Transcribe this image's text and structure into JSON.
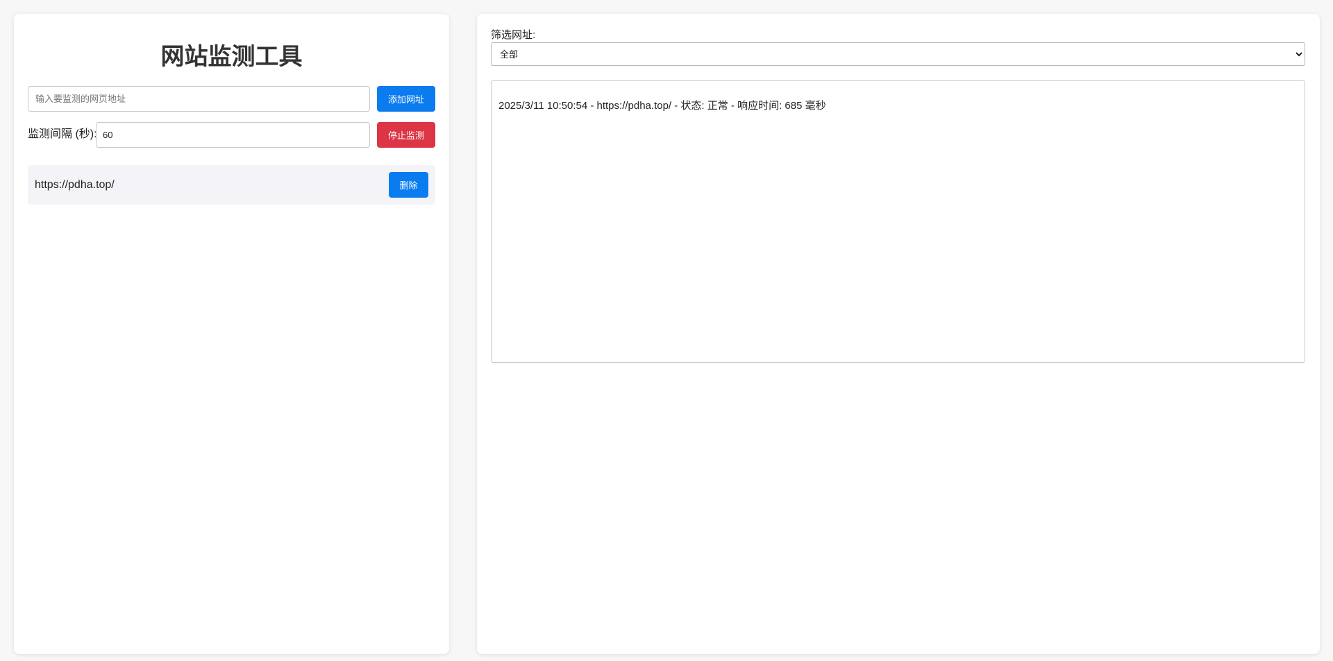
{
  "left_panel": {
    "title": "网站监测工具",
    "url_input": {
      "placeholder": "输入要监测的网页地址",
      "value": ""
    },
    "add_button_label": "添加网址",
    "interval_label": "监测间隔 (秒):",
    "interval_value": "60",
    "stop_button_label": "停止监测",
    "url_list": [
      {
        "url": "https://pdha.top/",
        "delete_label": "删除"
      }
    ]
  },
  "right_panel": {
    "filter_label": "筛选网址:",
    "filter_selected": "全部",
    "log_entries": [
      "2025/3/11 10:50:54 - https://pdha.top/ - 状态: 正常 - 响应时间: 685 毫秒"
    ]
  },
  "colors": {
    "primary": "#0a7cf0",
    "danger": "#dc3545",
    "list_item_bg": "#f3f3f8",
    "page_bg": "#f7f7f7"
  }
}
